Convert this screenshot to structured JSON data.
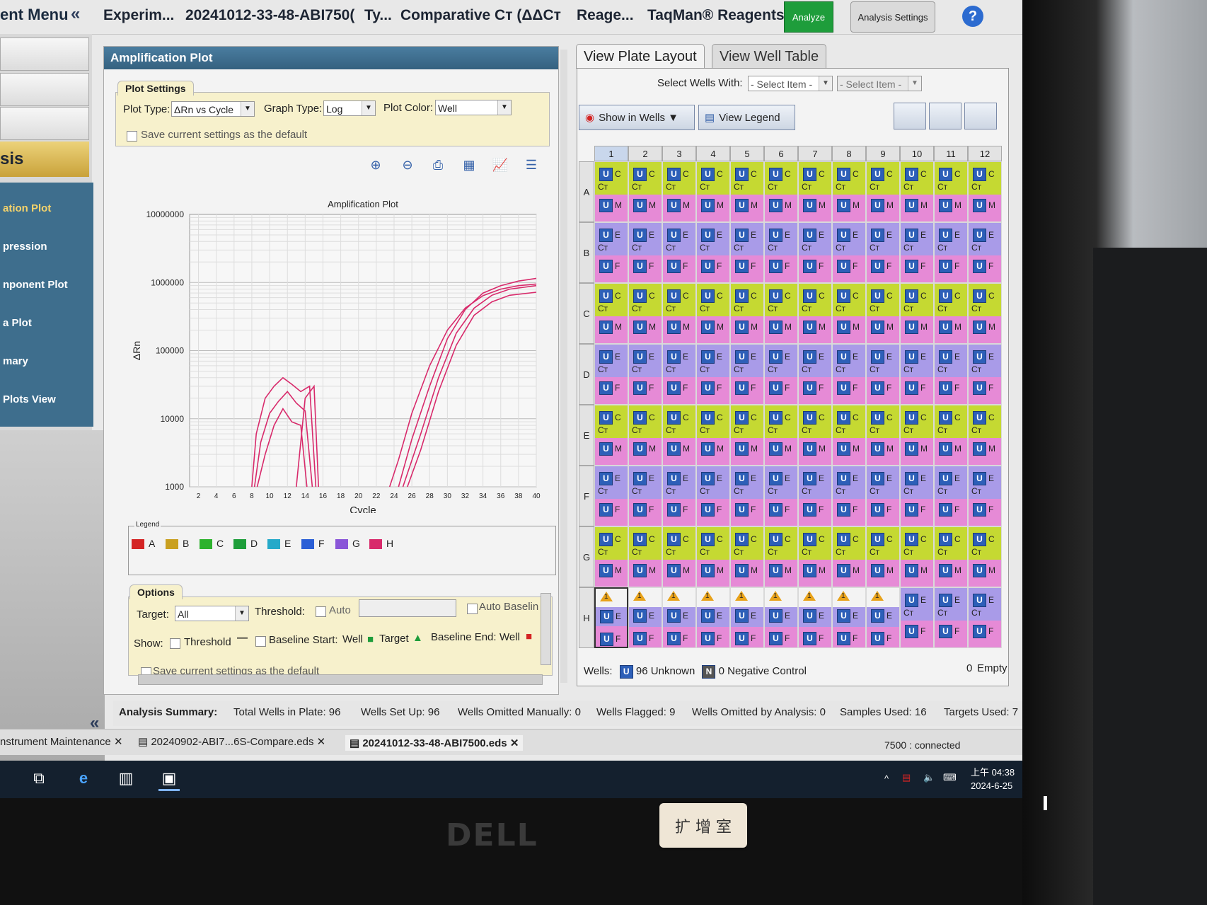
{
  "topbar": {
    "menu_title": "ent Menu",
    "collapse": "«",
    "crumbs": [
      "Experim...",
      "20241012-33-48-ABI750(",
      "Ty...",
      "Comparative Cт  (ΔΔCт",
      "Reage...",
      "TaqMan® Reagents"
    ],
    "analyze_label": "Analyze",
    "settings_label": "Analysis Settings",
    "help": "?"
  },
  "sidebar": {
    "section": "sis",
    "items": [
      "ation Plot",
      "pression",
      "nponent Plot",
      "a Plot",
      "mary",
      "Plots View"
    ],
    "collapse": "«"
  },
  "amp": {
    "title": "Amplification Plot",
    "plot_settings": "Plot Settings",
    "plot_type_label": "Plot Type:",
    "plot_type_value": "ΔRn vs Cycle",
    "graph_type_label": "Graph Type:",
    "graph_type_value": "Log",
    "plot_color_label": "Plot Color:",
    "plot_color_value": "Well",
    "save_default": "Save current settings as the default",
    "legend_title": "Legend",
    "legend": [
      {
        "label": "A",
        "color": "#d42424"
      },
      {
        "label": "B",
        "color": "#c9a020"
      },
      {
        "label": "C",
        "color": "#2db22d"
      },
      {
        "label": "D",
        "color": "#1e9e3a"
      },
      {
        "label": "E",
        "color": "#25a9c9"
      },
      {
        "label": "F",
        "color": "#2b5fd6"
      },
      {
        "label": "G",
        "color": "#8a56d8"
      },
      {
        "label": "H",
        "color": "#d82a6b"
      }
    ],
    "options": {
      "title": "Options",
      "target_label": "Target:",
      "target_value": "All",
      "threshold_label": "Threshold:",
      "auto_label": "Auto",
      "auto_baseline": "Auto Baselin",
      "show_label": "Show:",
      "show_threshold": "Threshold",
      "show_baseline": "Baseline Start:",
      "well_label": "Well",
      "target_word": "Target",
      "baseline_end": "Baseline End:",
      "well_label2": "Well",
      "save_default": "Save current settings as the default"
    }
  },
  "chart_data": {
    "type": "line",
    "title": "Amplification Plot",
    "xlabel": "Cycle",
    "ylabel": "ΔRn",
    "yscale": "log",
    "xlim": [
      1,
      40
    ],
    "ylim": [
      1000,
      10000000
    ],
    "xticks": [
      2,
      4,
      6,
      8,
      10,
      12,
      14,
      16,
      18,
      20,
      22,
      24,
      26,
      28,
      30,
      32,
      34,
      36,
      38,
      40
    ],
    "ytick_labels": [
      "10000000",
      "1000000",
      "100000",
      "10000",
      "1000"
    ],
    "grid": true,
    "series": [
      {
        "color": "#d82a6b",
        "x": [
          24.5,
          26,
          28,
          30,
          32,
          34,
          36,
          38,
          40
        ],
        "y": [
          1000,
          5000,
          30000,
          150000,
          400000,
          700000,
          900000,
          1050000,
          1150000
        ]
      },
      {
        "color": "#d82a6b",
        "x": [
          25,
          27,
          29,
          31,
          33,
          35,
          37,
          40
        ],
        "y": [
          1000,
          6000,
          40000,
          180000,
          420000,
          650000,
          800000,
          900000
        ]
      },
      {
        "color": "#d82a6b",
        "x": [
          25.5,
          27,
          29,
          31,
          33,
          35,
          37,
          40
        ],
        "y": [
          1000,
          3500,
          25000,
          120000,
          330000,
          520000,
          650000,
          720000
        ]
      },
      {
        "color": "#d82a6b",
        "x": [
          23.5,
          24.5,
          26,
          28,
          30,
          32,
          34,
          36,
          38,
          40
        ],
        "y": [
          1000,
          2500,
          12000,
          60000,
          200000,
          420000,
          640000,
          800000,
          900000,
          950000
        ]
      },
      {
        "color": "#d82a6b",
        "x": [
          8,
          8.5,
          9.5,
          10.5,
          11.5,
          12.5,
          13.5,
          14.5,
          15.2
        ],
        "y": [
          1000,
          6000,
          20000,
          30000,
          40000,
          32000,
          25000,
          30000,
          1000
        ]
      },
      {
        "color": "#d82a6b",
        "x": [
          8.3,
          9,
          10,
          11,
          12,
          13,
          14,
          14.8
        ],
        "y": [
          1000,
          4500,
          12000,
          18000,
          25000,
          17000,
          13000,
          1000
        ]
      },
      {
        "color": "#d82a6b",
        "x": [
          8.6,
          9.5,
          10.5,
          11.5,
          12.5,
          13.5,
          14.2
        ],
        "y": [
          1000,
          3000,
          8000,
          14000,
          9000,
          8000,
          1000
        ]
      },
      {
        "color": "#d82a6b",
        "x": [
          13,
          14,
          15,
          15.5
        ],
        "y": [
          1000,
          20000,
          30000,
          1000
        ]
      }
    ]
  },
  "plate": {
    "tab_plate": "View Plate Layout",
    "tab_table": "View Well Table",
    "select_wells_label": "Select Wells With:",
    "select_item_1": "- Select Item -",
    "select_item_2": "- Select Item -",
    "show_in_wells": "Show in Wells ▼",
    "view_legend": "View Legend",
    "columns": [
      "1",
      "2",
      "3",
      "4",
      "5",
      "6",
      "7",
      "8",
      "9",
      "10",
      "11",
      "12"
    ],
    "rows": [
      "A",
      "B",
      "C",
      "D",
      "E",
      "F",
      "G",
      "H"
    ],
    "row_targets": [
      {
        "top": "C",
        "bottom": "M",
        "top_color": "#c5d932",
        "bottom_color": "#e68ad6"
      },
      {
        "top": "E",
        "bottom": "F",
        "top_color": "#a99be8",
        "bottom_color": "#e68ad6"
      },
      {
        "top": "C",
        "bottom": "M",
        "top_color": "#c5d932",
        "bottom_color": "#e68ad6"
      },
      {
        "top": "E",
        "bottom": "F",
        "top_color": "#a99be8",
        "bottom_color": "#e68ad6"
      },
      {
        "top": "C",
        "bottom": "M",
        "top_color": "#c5d932",
        "bottom_color": "#e68ad6"
      },
      {
        "top": "E",
        "bottom": "F",
        "top_color": "#a99be8",
        "bottom_color": "#e68ad6"
      },
      {
        "top": "C",
        "bottom": "M",
        "top_color": "#c5d932",
        "bottom_color": "#e68ad6"
      },
      {
        "top": "E",
        "bottom": "F",
        "top_color": "#a99be8",
        "bottom_color": "#e68ad6"
      }
    ],
    "ct_label": "Cт",
    "unknown_badge": "U",
    "flag_label": "1",
    "flagged_wells_row_H": 9,
    "footer": {
      "wells_label": "Wells:",
      "unknown_count": "96",
      "unknown_label": "Unknown",
      "neg_badge": "N",
      "neg_count": "0",
      "neg_label": "Negative Control",
      "empty_count": "0",
      "empty_label": "Empty"
    }
  },
  "summary": {
    "label": "Analysis Summary:",
    "total": "Total Wells in Plate: 96",
    "setup": "Wells Set Up: 96",
    "omitted_manual": "Wells Omitted Manually: 0",
    "flagged": "Wells Flagged: 9",
    "omitted_analysis": "Wells Omitted by Analysis: 0",
    "samples": "Samples Used: 16",
    "targets": "Targets Used: 7"
  },
  "filetabs": [
    "nstrument Maintenance",
    "20240902-ABI7...6S-Compare.eds",
    "20241012-33-48-ABI7500.eds"
  ],
  "status": "7500 : connected",
  "taskbar": {
    "time": "上午 04:38",
    "date": "2024-6-25"
  },
  "hardware": {
    "brand": "DELL",
    "room_label": "扩 增 室"
  }
}
